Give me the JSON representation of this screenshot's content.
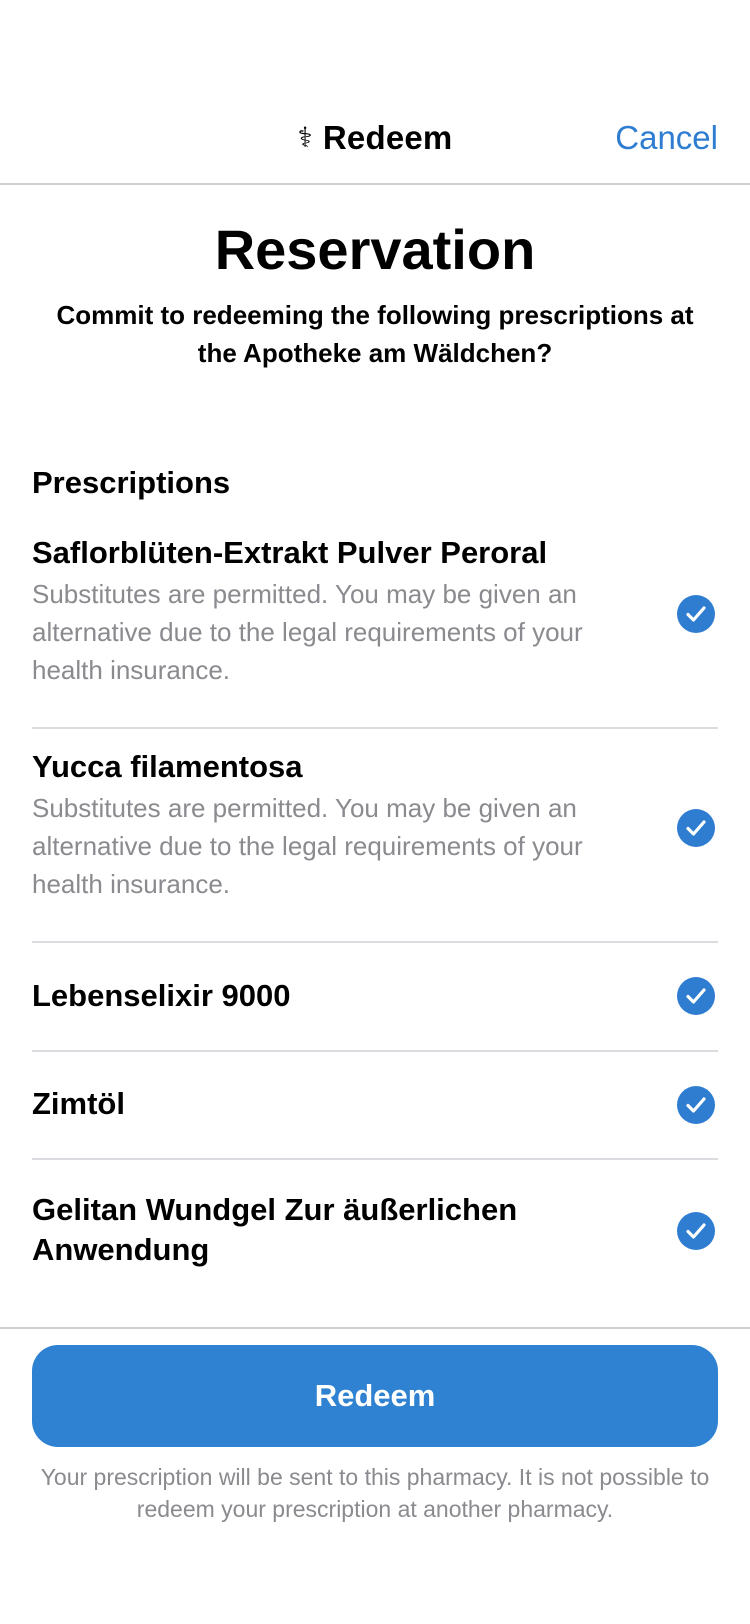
{
  "nav": {
    "title_icon": "⚕",
    "title": "Redeem",
    "cancel_label": "Cancel"
  },
  "header": {
    "title": "Reservation",
    "subtitle": "Commit to redeeming the following prescriptions at the Apotheke am Wäldchen?"
  },
  "prescriptions": {
    "section_title": "Prescriptions",
    "items": [
      {
        "name": "Saflorblüten-Extrakt Pulver Peroral",
        "description": "Substitutes are permitted. You may be given an alternative due to the legal requirements of your health insurance.",
        "selected": true
      },
      {
        "name": "Yucca filamentosa",
        "description": "Substitutes are permitted. You may be given an alternative due to the legal requirements of your health insurance.",
        "selected": true
      },
      {
        "name": "Lebenselixir 9000",
        "selected": true
      },
      {
        "name": "Zimtöl",
        "selected": true
      },
      {
        "name": "Gelitan Wundgel Zur äußerlichen Anwendung",
        "selected": true
      }
    ]
  },
  "footer": {
    "redeem_label": "Redeem",
    "note": "Your prescription will be sent to this pharmacy. It is not possible to redeem your prescription at another pharmacy."
  },
  "colors": {
    "accent": "#2E7DD1",
    "secondary_text": "#8A8A8F",
    "separator": "#DCDCE0"
  },
  "icons": {
    "title_icon": "caduceus-icon",
    "selection": "checkmark-circle-icon"
  }
}
